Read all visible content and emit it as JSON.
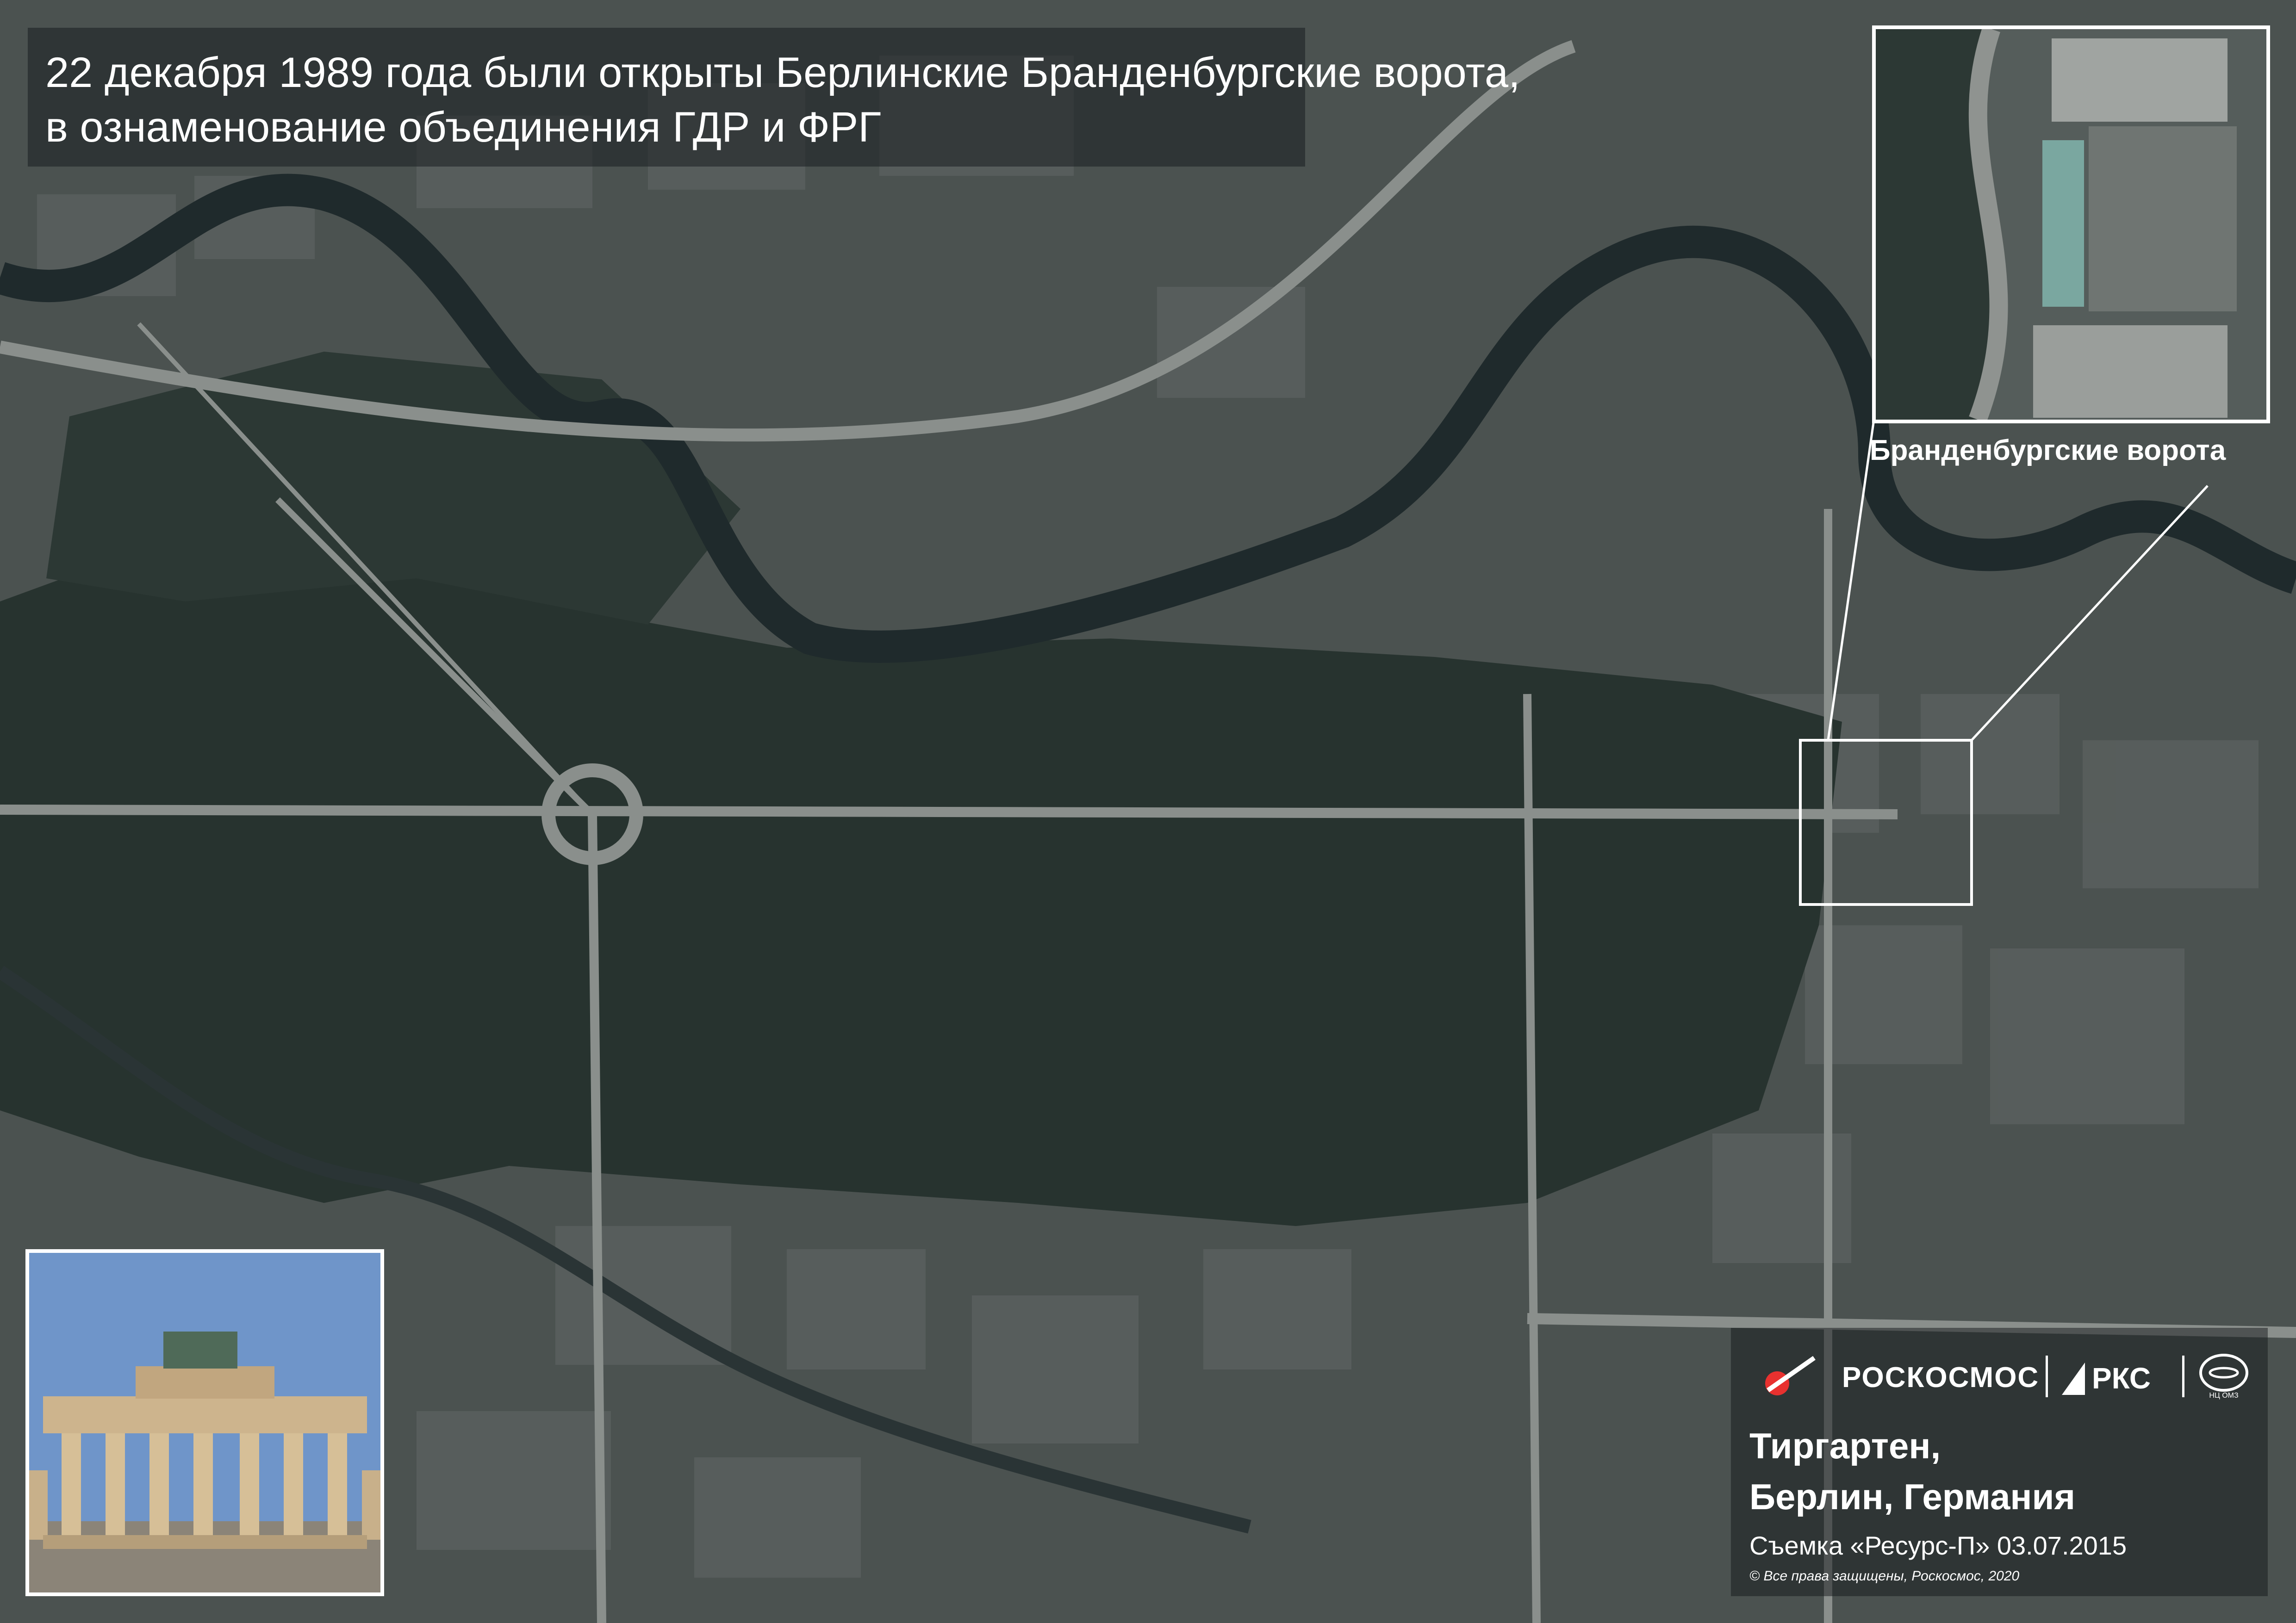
{
  "headline": {
    "line1": "22 декабря 1989 года были открыты Берлинские Бранденбургские ворота,",
    "line2": "в ознаменование объединения ГДР и ФРГ"
  },
  "inset": {
    "label": "Бранденбургские ворота"
  },
  "brand": {
    "roscosmos": "РОСКОСМОС",
    "rks": "РКС",
    "ntsomz_logo_text": "НЦ ОМЗ"
  },
  "caption": {
    "place_line1": "Тиргартен,",
    "place_line2": "Берлин, Германия",
    "shot": "Съемка «Ресурс-П» 03.07.2015",
    "rights": "© Все права защищены, Роскосмос, 2020"
  },
  "colors": {
    "park": "#27332f",
    "city": "#4e5553",
    "river": "#1f2a2c",
    "road": "#8a8f8c",
    "white": "#ffffff"
  }
}
